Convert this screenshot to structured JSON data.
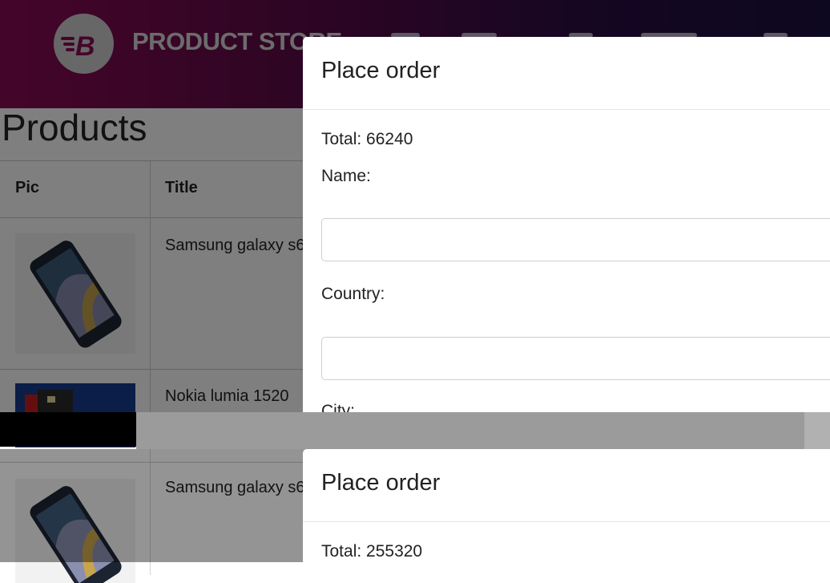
{
  "navbar": {
    "brand": "PRODUCT STORE",
    "logo_letter": "B"
  },
  "products": {
    "heading": "Products",
    "columns": [
      "Pic",
      "Title"
    ],
    "rows": [
      {
        "title": "Samsung galaxy s6",
        "image": "samsung-galaxy-s6-image"
      },
      {
        "title": "Nokia lumia 1520",
        "image": "nokia-lumia-1520-image"
      },
      {
        "title": "Samsung galaxy s6",
        "image": "samsung-galaxy-s6-image"
      }
    ]
  },
  "modal_top": {
    "title": "Place order",
    "total": "Total: 66240",
    "name_label": "Name:",
    "country_label": "Country:",
    "city_label": "City:"
  },
  "modal_bottom": {
    "title": "Place order",
    "total": "Total: 255320"
  },
  "colors": {
    "navbar_start": "#8a0b56",
    "navbar_end": "#1a0f3e"
  }
}
